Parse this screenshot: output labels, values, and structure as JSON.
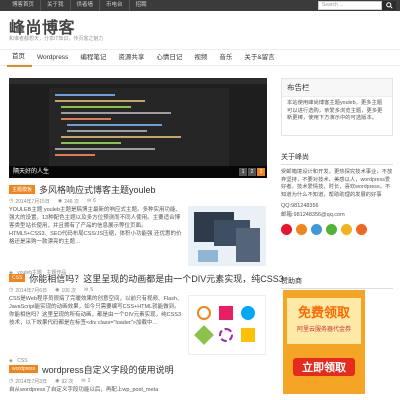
{
  "topbar": {
    "links": [
      "博客首页",
      "关于我",
      "供者墙",
      "币电台",
      "招聘"
    ],
    "search_placeholder": "Search ..."
  },
  "header": {
    "logo": "峰尚博客",
    "tagline": "和谁者都想天，分享IT知识，传页客之魅力"
  },
  "nav": {
    "items": [
      "首页",
      "Wordpress",
      "编程笔记",
      "资源共享",
      "心情日记",
      "视频",
      "音乐",
      "关于&留言"
    ]
  },
  "slider": {
    "caption": "隔天好的人生",
    "pages": [
      "1",
      "2",
      "3"
    ]
  },
  "posts": [
    {
      "tag": "主题模板",
      "title": "多风格响应式博客主题youleb",
      "date": "2014年7月15日",
      "views": "246 次",
      "comments": "6",
      "excerpt": "YOULEB主题 youleb主题是稿博主最新的响应式主题。多种实用功能、强大的设置，13种配色主题以及多方位预测而不同人使用。主要适合博客类型站长使用，并且拥有了产品的信息展示等位页面。HTML5+CSS3、SEO代码布局CSS/JS压缩，体积小功能强 还优惠的价格还是采购一款漂亮的主题…",
      "tags": [
        "youleb主题",
        "主题作品"
      ]
    },
    {
      "tag": "CSS",
      "title": "你能相信吗？这里呈现的动画都是由一个DIV元素实现，纯CSS3",
      "date": "2014年7月6日",
      "views": "106 次",
      "comments": "5",
      "excerpt": "CSS是Web程序员很搞了完暖效果的创意空间，以前只有视频、Flash、JavaScript能实现的动画效果，如今只需要编写CSS+HTML就能做到。你能相信吗？这里呈现的所有动画，都是由一个DIV元素实现，纯CSS3技术，以下效果代码都是在标签<div class=\"loader\">加载中…",
      "tags": [
        "CSS"
      ]
    },
    {
      "tag": "wordpress",
      "title": "wordpress自定义字段的使用说明",
      "date": "2014年7月3日",
      "views": "92 次",
      "comments": "2",
      "excerpt": "自从wordpress了自定义字段功能以后，再配上wp_post_meta",
      "tags": []
    }
  ],
  "sidebar": {
    "notice_title": "布告栏",
    "notice_text": "本站使用峰尚博客主题youleb，更多主题可以进行选购，亲爱多浏览主题，更多更新更棒，使用下方演示中的可选版本。",
    "about_title": "关于峰尚",
    "about_text": "受邮箱境设计和开发，更热探究技术事业，不放弃坚持，不要对技术、美感以人，wordpress爱好者，技术爱情技，时长，喜欢wordpress，不知道为什么不知道，帮助助理的发展的好事",
    "qq": "QQ:981248356",
    "email": "邮箱:981248356@qq.com",
    "ads_title": "赞助商",
    "ad_big": "免费领取",
    "ad_small": "阿里云服务器代金券",
    "ad_button": "立即领取"
  },
  "colors": {
    "accent": "#f08519",
    "topbar": "#3b3b3b",
    "ad_bg": "#f5a524",
    "ad_button": "#e62b1e"
  }
}
